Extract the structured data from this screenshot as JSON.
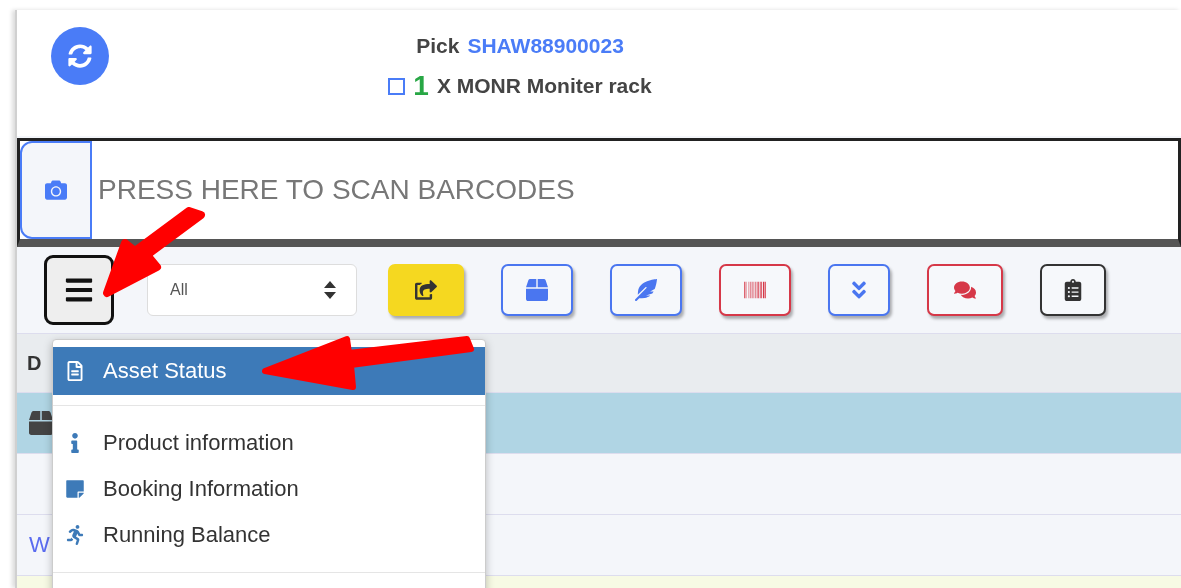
{
  "header": {
    "title": "Pick",
    "order_id": "SHAW88900023",
    "item": {
      "checked": false,
      "quantity": "1",
      "description": "X MONR Moniter rack"
    }
  },
  "scan": {
    "placeholder": "PRESS HERE TO SCAN BARCODES"
  },
  "toolbar": {
    "filter": "All",
    "buttons": [
      {
        "kind": "share",
        "color": "#f5d820",
        "filled": true
      },
      {
        "kind": "box",
        "color": "#4a76f0",
        "filled": false
      },
      {
        "kind": "feather",
        "color": "#4a76f0",
        "filled": false
      },
      {
        "kind": "barcode",
        "color": "#d63848",
        "filled": false
      },
      {
        "kind": "double-down",
        "color": "#4a76f0",
        "filled": false
      },
      {
        "kind": "comments",
        "color": "#d63848",
        "filled": false
      },
      {
        "kind": "clipboard",
        "color": "#333333",
        "filled": false
      }
    ]
  },
  "table": {
    "column_1": "D",
    "rows": [
      {
        "kind": "icon",
        "selected": true,
        "highlighted": false
      },
      {
        "kind": "empty",
        "selected": false,
        "highlighted": false
      },
      {
        "kind": "link",
        "text": "W",
        "selected": false,
        "highlighted": false
      },
      {
        "kind": "empty",
        "selected": false,
        "highlighted": true
      }
    ]
  },
  "menu": {
    "groups": [
      [
        {
          "kind": "file",
          "label": "Asset Status",
          "selected": true
        }
      ],
      [
        {
          "kind": "info",
          "label": "Product information",
          "selected": false
        },
        {
          "kind": "note",
          "label": "Booking Information",
          "selected": false
        },
        {
          "kind": "runner",
          "label": "Running Balance",
          "selected": false
        }
      ]
    ]
  }
}
